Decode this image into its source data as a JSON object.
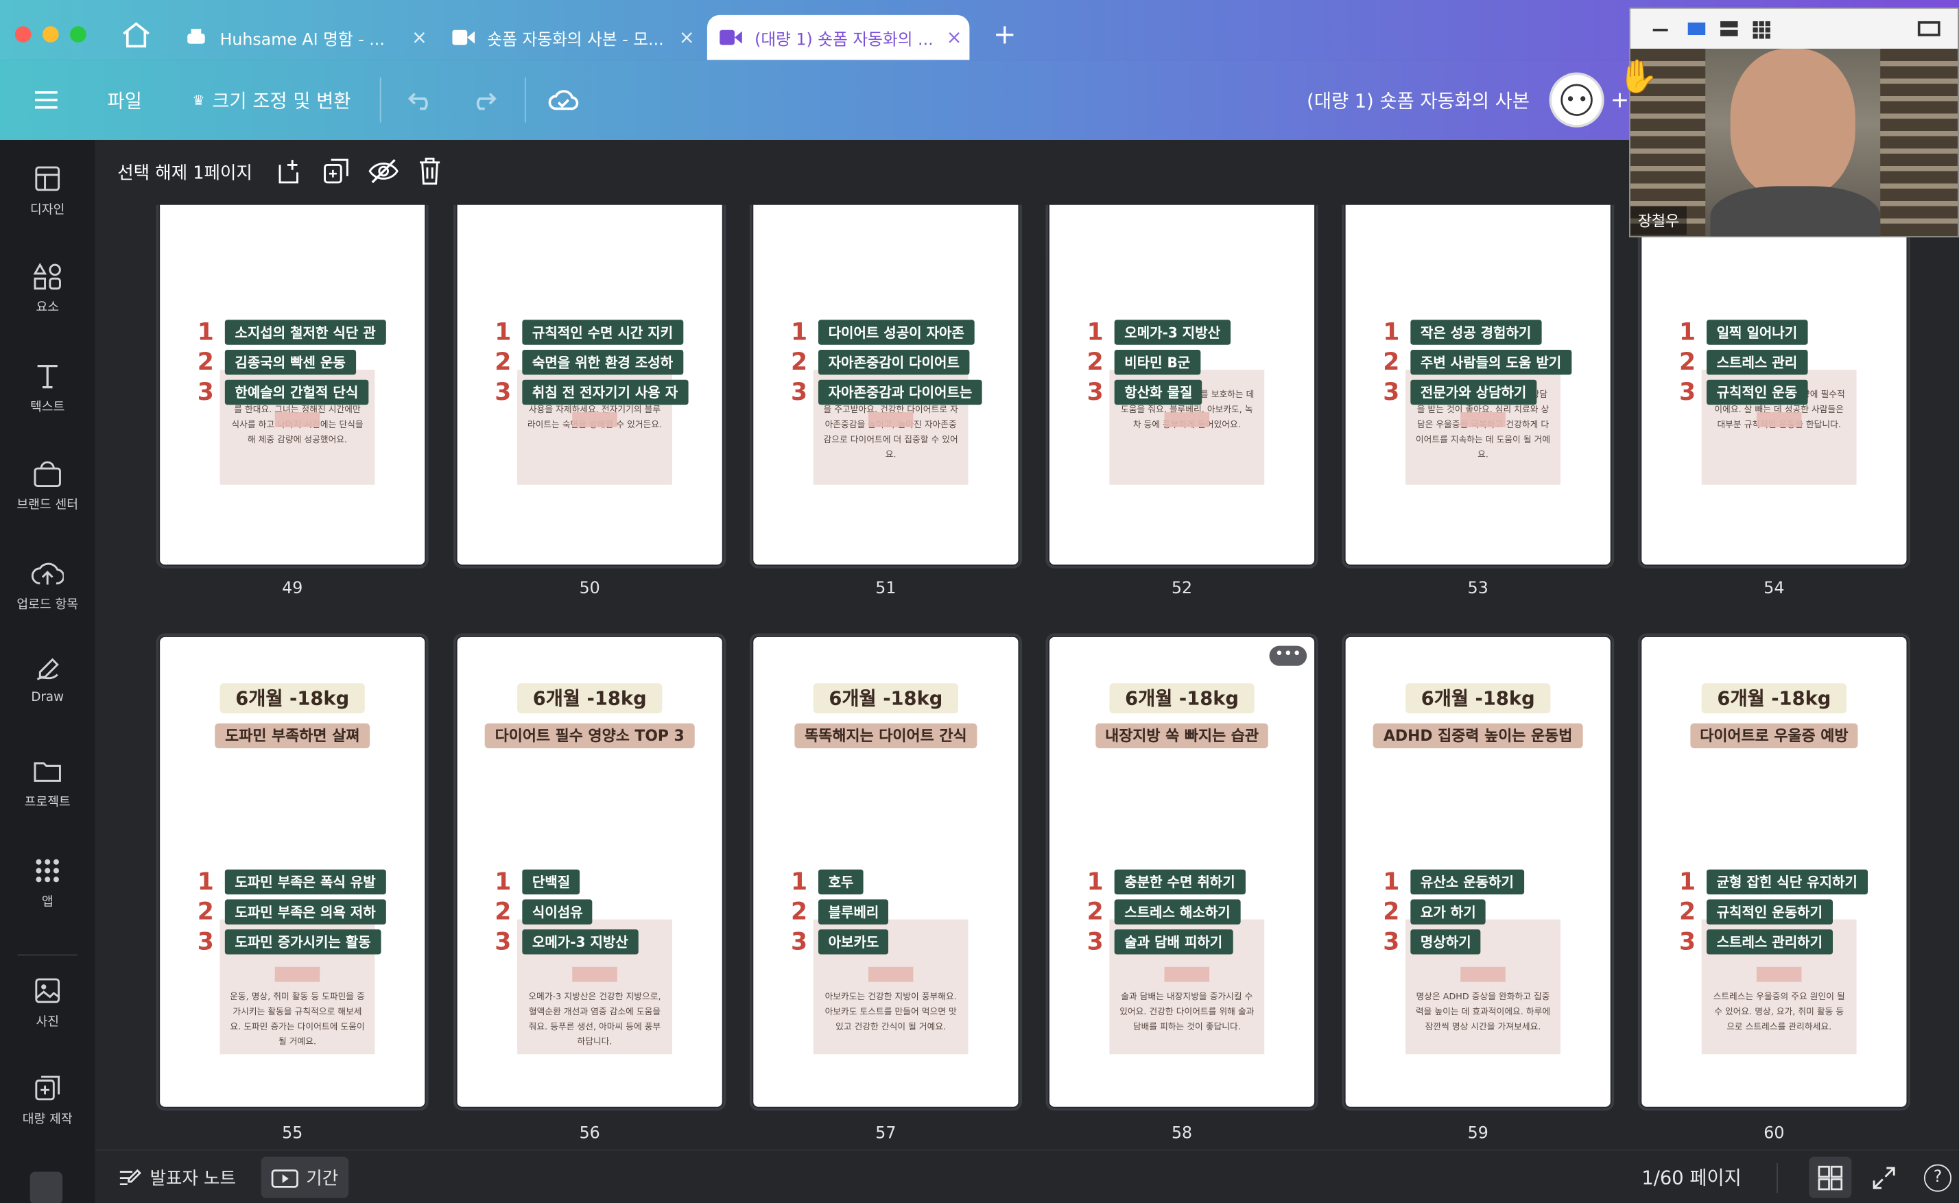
{
  "tabs": [
    {
      "label": "Huhsame AI 명함 - ..."
    },
    {
      "label": "숏폼 자동화의 사본 - 모..."
    },
    {
      "label": "(대량 1) 숏폼 자동화의 ..."
    }
  ],
  "toolbar": {
    "file": "파일",
    "resize": "크기 조정 및 변환",
    "doc_title": "(대량 1) 숏폼 자동화의 사본"
  },
  "subbar": {
    "label": "선택 해제 1페이지"
  },
  "sidebar": [
    "디자인",
    "요소",
    "텍스트",
    "브랜드 센터",
    "업로드 항목",
    "Draw",
    "프로젝트",
    "앱",
    "사진",
    "대량 제작"
  ],
  "video": {
    "name": "장철우"
  },
  "bottom": {
    "notes": "발표자 노트",
    "timer": "기간",
    "page": "1/60 페이지"
  },
  "pages_top": [
    {
      "num": "49",
      "items": [
        "소지섭의 철저한 식단 관",
        "김종국의 빡센 운동",
        "한예슬의 간헐적 단식"
      ],
      "body": "한예슬은 간헐적 단식으로 몸매 관리를 한대요. 그녀는 정해진 시간에만 식사를 하고 나머지 시간에는 단식을 해 체중 감량에 성공했어요."
    },
    {
      "num": "50",
      "items": [
        "규칙적인 수면 시간 지키",
        "숙면을 위한 환경 조성하",
        "취침 전 전자기기 사용 자"
      ],
      "body": "취침 전 TV, 스마트폰, 컴퓨터 등의 사용을 자제하세요. 전자기기의 블루라이트는 숙면을 방해할 수 있거든요."
    },
    {
      "num": "51",
      "items": [
        "다이어트 성공이 자아존",
        "자아존중감이 다이어트",
        "자아존중감과 다이어트는"
      ],
      "body": "다이어트와 자아존중감은 서로 영향을 주고받아요. 건강한 다이어트로 자아존중감을 높이고, 높아진 자아존중감으로 다이어트에 더 집중할 수 있어요."
    },
    {
      "num": "52",
      "items": [
        "오메가-3 지방산",
        "비타민 B군",
        "항산화 물질"
      ],
      "body": "항산화 물질은 뇌 세포를 보호하는 데 도움을 줘요. 블루베리, 아보카도, 녹차 등에 풍부하게 들어있어요."
    },
    {
      "num": "53",
      "items": [
        "작은 성공 경험하기",
        "주변 사람들의 도움 받기",
        "전문가와 상담하기"
      ],
      "body": "우울증이 심각하다면 전문가와 상담을 받는 것이 좋아요. 심리 치료와 상담은 우울증을 극복하고 건강하게 다이어트를 지속하는 데 도움이 될 거예요."
    },
    {
      "num": "54",
      "items": [
        "일찍 일어나기",
        "스트레스 관리",
        "규칙적인 운동"
      ],
      "body": "규칙적인 운동은 체중 감량에 필수적이에요. 살 빼는 데 성공한 사람들은 대부분 규칙적인 운동을 한답니다."
    }
  ],
  "pages_bottom": [
    {
      "num": "55",
      "h1": "6개월 -18kg",
      "h2": "도파민 부족하면 살쪄",
      "items": [
        "도파민 부족은 폭식 유발",
        "도파민 부족은 의욕 저하",
        "도파민 증가시키는 활동"
      ],
      "body": "운동, 명상, 취미 활동 등 도파민을 증가시키는 활동을 규칙적으로 해보세요. 도파민 증가는 다이어트에 도움이 될 거예요."
    },
    {
      "num": "56",
      "h1": "6개월 -18kg",
      "h2": "다이어트 필수 영양소 TOP 3",
      "items": [
        "단백질",
        "식이섬유",
        "오메가-3 지방산"
      ],
      "body": "오메가-3 지방산은 건강한 지방으로, 혈액순환 개선과 염증 감소에 도움을 줘요. 등푸른 생선, 아마씨 등에 풍부하답니다."
    },
    {
      "num": "57",
      "h1": "6개월 -18kg",
      "h2": "똑똑해지는 다이어트 간식",
      "items": [
        "호두",
        "블루베리",
        "아보카도"
      ],
      "body": "아보카도는 건강한 지방이 풍부해요. 아보카도 토스트를 만들어 먹으면 맛있고 건강한 간식이 될 거예요."
    },
    {
      "num": "58",
      "h1": "6개월 -18kg",
      "h2": "내장지방 쏙 빠지는 습관",
      "items": [
        "충분한 수면 취하기",
        "스트레스 해소하기",
        "술과 담배 피하기"
      ],
      "body": "술과 담배는 내장지방을 증가시킬 수 있어요. 건강한 다이어트를 위해 술과 담배를 피하는 것이 좋답니다."
    },
    {
      "num": "59",
      "h1": "6개월 -18kg",
      "h2": "ADHD 집중력 높이는 운동법",
      "items": [
        "유산소 운동하기",
        "요가 하기",
        "명상하기"
      ],
      "body": "명상은 ADHD 증상을 완화하고 집중력을 높이는 데 효과적이에요. 하루에 잠깐씩 명상 시간을 가져보세요."
    },
    {
      "num": "60",
      "h1": "6개월 -18kg",
      "h2": "다이어트로 우울증 예방",
      "items": [
        "균형 잡힌 식단 유지하기",
        "규칙적인 운동하기",
        "스트레스 관리하기"
      ],
      "body": "스트레스는 우울증의 주요 원인이 될 수 있어요. 명상, 요가, 취미 활동 등으로 스트레스를 관리하세요."
    }
  ],
  "list_numbers": [
    "1",
    "2",
    "3"
  ]
}
